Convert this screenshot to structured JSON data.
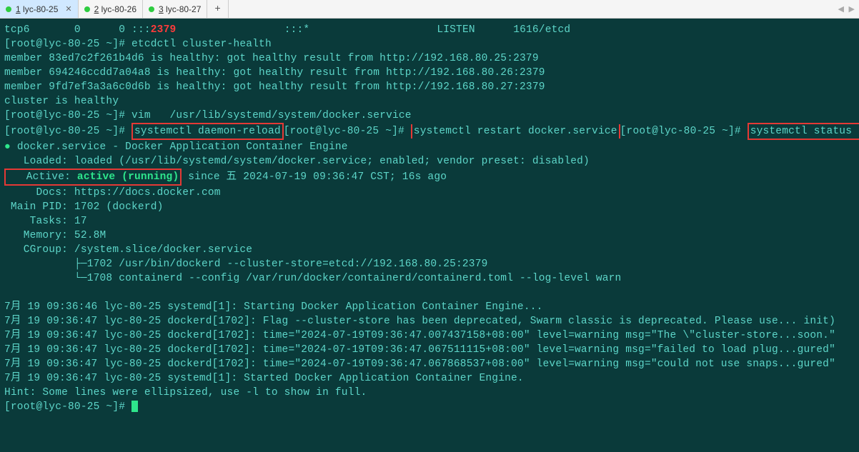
{
  "tabs": [
    {
      "index": "1",
      "label": "lyc-80-25",
      "active": true
    },
    {
      "index": "2",
      "label": "lyc-80-26",
      "active": false
    },
    {
      "index": "3",
      "label": "lyc-80-27",
      "active": false
    }
  ],
  "line_tcp": {
    "proto": "tcp6",
    "a": "0",
    "b": "0 :::",
    "port": "2379",
    "c": ":::*",
    "state": "LISTEN",
    "pid": "1616/etcd"
  },
  "prompt": "[root@lyc-80-25 ~]# ",
  "cmds": {
    "etcdctl": "etcdctl cluster-health",
    "vim": "vim   /usr/lib/systemd/system/docker.service",
    "daemon_reload": "systemctl daemon-reload",
    "restart": "systemctl restart docker.service",
    "status": "systemctl status  docker.service"
  },
  "members": [
    "member 83ed7c2f261b4d6 is healthy: got healthy result from http://192.168.80.25:2379",
    "member 694246ccdd7a04a8 is healthy: got healthy result from http://192.168.80.26:2379",
    "member 9fd7ef3a3a6c0d6b is healthy: got healthy result from http://192.168.80.27:2379"
  ],
  "cluster_healthy": "cluster is healthy",
  "svc": {
    "title": "docker.service - Docker Application Container Engine",
    "loaded": "   Loaded: loaded (/usr/lib/systemd/system/docker.service; enabled; vendor preset: disabled)",
    "active_prefix": "   Active: ",
    "active_val": "active (running)",
    "active_suffix": " since 五 2024-07-19 09:36:47 CST; 16s ago",
    "docs": "     Docs: https://docs.docker.com",
    "mainpid": " Main PID: 1702 (dockerd)",
    "tasks": "    Tasks: 17",
    "memory": "   Memory: 52.8M",
    "cgroup": "   CGroup: /system.slice/docker.service",
    "proc1": "           ├─1702 /usr/bin/dockerd --cluster-store=etcd://192.168.80.25:2379",
    "proc2": "           └─1708 containerd --config /var/run/docker/containerd/containerd.toml --log-level warn"
  },
  "logs": [
    "7月 19 09:36:46 lyc-80-25 systemd[1]: Starting Docker Application Container Engine...",
    "7月 19 09:36:47 lyc-80-25 dockerd[1702]: Flag --cluster-store has been deprecated, Swarm classic is deprecated. Please use... init)",
    "7月 19 09:36:47 lyc-80-25 dockerd[1702]: time=\"2024-07-19T09:36:47.007437158+08:00\" level=warning msg=\"The \\\"cluster-store...soon.\"",
    "7月 19 09:36:47 lyc-80-25 dockerd[1702]: time=\"2024-07-19T09:36:47.067511115+08:00\" level=warning msg=\"failed to load plug...gured\"",
    "7月 19 09:36:47 lyc-80-25 dockerd[1702]: time=\"2024-07-19T09:36:47.067868537+08:00\" level=warning msg=\"could not use snaps...gured\"",
    "7月 19 09:36:47 lyc-80-25 systemd[1]: Started Docker Application Container Engine."
  ],
  "hint": "Hint: Some lines were ellipsized, use -l to show in full."
}
